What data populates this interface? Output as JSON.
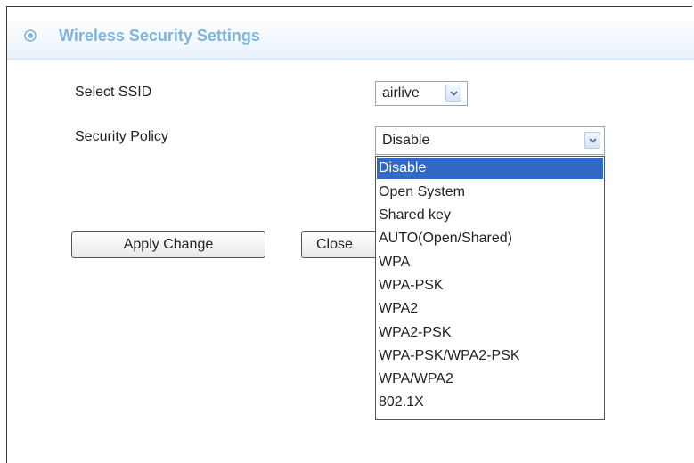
{
  "header": {
    "title": "Wireless Security Settings",
    "icon": "target-bullet-icon"
  },
  "form": {
    "ssid_label": "Select SSID",
    "ssid_value": "airlive",
    "policy_label": "Security Policy",
    "policy_value": "Disable"
  },
  "buttons": {
    "apply": "Apply Change",
    "close": "Close"
  },
  "dropdown": {
    "options": [
      "Disable",
      "Open System",
      "Shared key",
      "AUTO(Open/Shared)",
      "WPA",
      "WPA-PSK",
      "WPA2",
      "WPA2-PSK",
      "WPA-PSK/WPA2-PSK",
      "WPA/WPA2",
      "802.1X"
    ],
    "selected_index": 0
  },
  "colors": {
    "title": "#7fb4dc",
    "selection": "#3169c6"
  }
}
